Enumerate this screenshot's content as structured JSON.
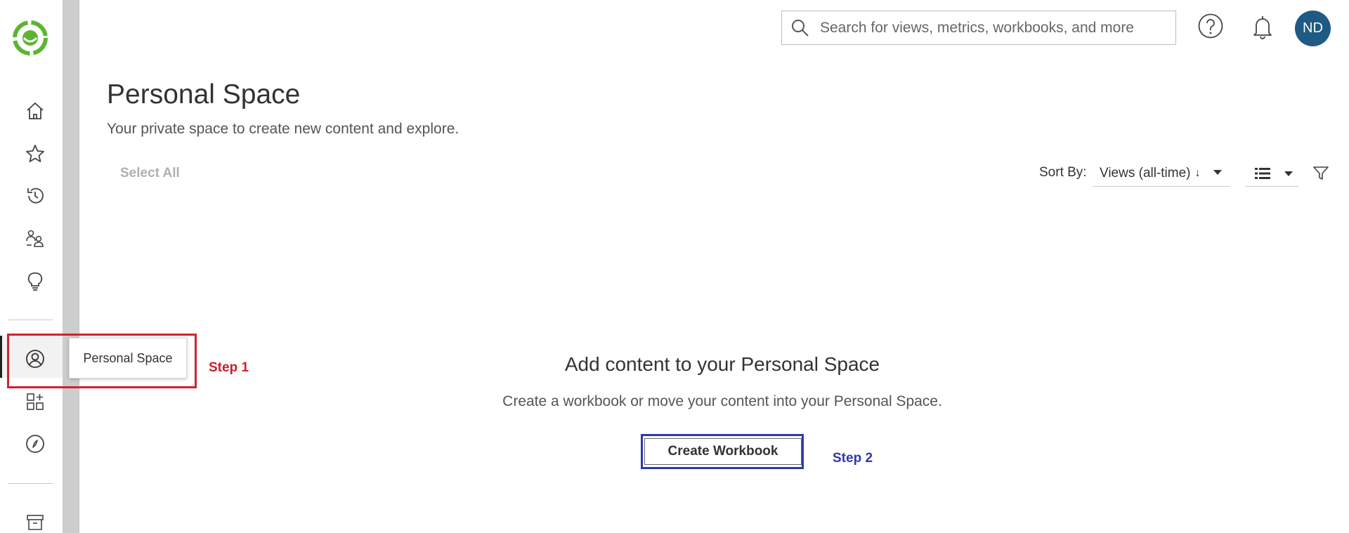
{
  "header": {
    "search_placeholder": "Search for views, metrics, workbooks, and more",
    "avatar_initials": "ND"
  },
  "page": {
    "title": "Personal Space",
    "subtitle": "Your private space to create new content and explore."
  },
  "toolbar": {
    "select_all": "Select All",
    "sort_label": "Sort By:",
    "sort_value": "Views (all-time)",
    "sort_direction_glyph": "↓"
  },
  "sidebar": {
    "items": [
      {
        "icon": "home-icon"
      },
      {
        "icon": "star-icon"
      },
      {
        "icon": "history-icon"
      },
      {
        "icon": "collaboration-icon"
      },
      {
        "icon": "lightbulb-icon"
      },
      {
        "icon": "person-icon"
      },
      {
        "icon": "dashboard-add-icon"
      },
      {
        "icon": "compass-icon"
      },
      {
        "icon": "archive-icon"
      }
    ],
    "tooltip": "Personal Space"
  },
  "empty_state": {
    "title": "Add content to your Personal Space",
    "description": "Create a workbook or move your content into your Personal Space.",
    "button_label": "Create Workbook"
  },
  "annotations": {
    "step1": "Step 1",
    "step2": "Step 2"
  },
  "colors": {
    "brand_green": "#5cb531",
    "avatar_bg": "#1f5a84",
    "step1_red": "#d0222e",
    "step2_blue": "#2e3aa8"
  }
}
